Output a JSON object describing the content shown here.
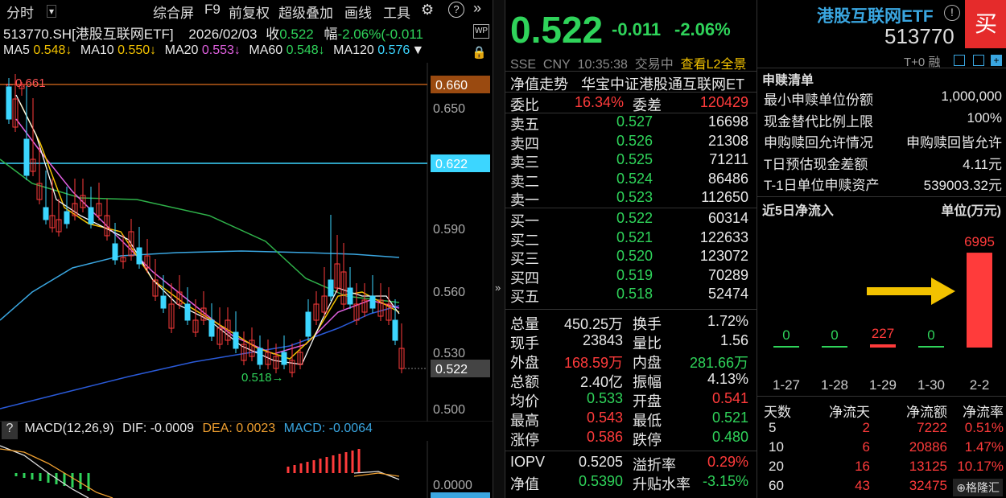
{
  "toolbar": {
    "timeshare": "分时",
    "combined": "综合屏",
    "f9": "F9",
    "adjust": "前复权",
    "overlay": "超级叠加",
    "draw": "画线",
    "tools": "工具"
  },
  "info": {
    "code": "513770.SH[港股互联网ETF]",
    "date": "2026/02/03",
    "close_label": "收",
    "close": "0.522",
    "chg_label": "幅",
    "chg": "-2.06%(-0.011"
  },
  "ma": {
    "ma5": "MA5",
    "ma5v": "0.548↓",
    "ma10": "MA10",
    "ma10v": "0.550↓",
    "ma20": "MA20",
    "ma20v": "0.553↓",
    "ma60": "MA60",
    "ma60v": "0.548↓",
    "ma120": "MA120",
    "ma120v": "0.576"
  },
  "kchart": {
    "price_tags": {
      "high_tag": "0.660",
      "line_tag": "0.622",
      "last_tag": "0.522"
    },
    "y_ticks": [
      "0.650",
      "0.590",
      "0.560",
      "0.530",
      "0.500"
    ],
    "marker_high": "0.661",
    "marker_low": "0.518",
    "macd_zero": "0.0000",
    "macd_low": "-0.0064"
  },
  "macd": {
    "label": "MACD(12,26,9)",
    "dif": "DIF: -0.0009",
    "dea": "DEA: 0.0023",
    "macd": "MACD: -0.0064"
  },
  "quote": {
    "price": "0.522",
    "change": "-0.011",
    "pct": "-2.06%",
    "exch": "SSE",
    "cur": "CNY",
    "time": "10:35:38",
    "status": "交易中",
    "l2": "查看L2全景",
    "name": "港股互联网ETF",
    "code": "513770",
    "buy": "买",
    "t0": "T+0",
    "rong": "融"
  },
  "nav": {
    "label": "净值走势",
    "name": "华宝中证港股通互联网ET"
  },
  "wei": {
    "l1": "委比",
    "v1": "16.34%",
    "l2": "委差",
    "v2": "120429"
  },
  "asks": [
    {
      "l": "卖五",
      "p": "0.527",
      "v": "16698"
    },
    {
      "l": "卖四",
      "p": "0.526",
      "v": "21308"
    },
    {
      "l": "卖三",
      "p": "0.525",
      "v": "71211"
    },
    {
      "l": "卖二",
      "p": "0.524",
      "v": "86486"
    },
    {
      "l": "卖一",
      "p": "0.523",
      "v": "112650"
    }
  ],
  "bids": [
    {
      "l": "买一",
      "p": "0.522",
      "v": "60314"
    },
    {
      "l": "买二",
      "p": "0.521",
      "v": "122633"
    },
    {
      "l": "买三",
      "p": "0.520",
      "v": "123072"
    },
    {
      "l": "买四",
      "p": "0.519",
      "v": "70289"
    },
    {
      "l": "买五",
      "p": "0.518",
      "v": "52474"
    }
  ],
  "stats": [
    {
      "l1": "总量",
      "v1": "450.25万",
      "l2": "换手",
      "v2": "1.72%"
    },
    {
      "l1": "现手",
      "v1": "23843",
      "l2": "量比",
      "v2": "1.56"
    },
    {
      "l1": "外盘",
      "v1": "168.59万",
      "l2": "内盘",
      "v2": "281.66万"
    },
    {
      "l1": "总额",
      "v1": "2.40亿",
      "l2": "振幅",
      "v2": "4.13%"
    },
    {
      "l1": "均价",
      "v1": "0.533",
      "l2": "开盘",
      "v2": "0.541"
    },
    {
      "l1": "最高",
      "v1": "0.543",
      "l2": "最低",
      "v2": "0.521"
    },
    {
      "l1": "涨停",
      "v1": "0.586",
      "l2": "跌停",
      "v2": "0.480"
    }
  ],
  "iopv": [
    {
      "l1": "IOPV",
      "v1": "0.5205",
      "l2": "溢折率",
      "v2": "0.29%"
    },
    {
      "l1": "净值",
      "v1": "0.5390",
      "l2": "升贴水率",
      "v2": "-3.15%"
    }
  ],
  "redeem": {
    "title": "申赎清单",
    "rows": [
      {
        "l": "最小申赎单位份额",
        "v": "1,000,000"
      },
      {
        "l": "现金替代比例上限",
        "v": "100%"
      },
      {
        "l": "申购赎回允许情况",
        "v": "申购赎回皆允许"
      },
      {
        "l": "T日预估现金差额",
        "v": "4.11元"
      },
      {
        "l": "T-1日单位申赎资产",
        "v": "539003.32元"
      }
    ]
  },
  "flow": {
    "title": "近5日净流入",
    "unit": "单位(万元)",
    "bars": [
      {
        "d": "1-27",
        "v": 0,
        "t": "0"
      },
      {
        "d": "1-28",
        "v": 0,
        "t": "0"
      },
      {
        "d": "1-29",
        "v": 227,
        "t": "227"
      },
      {
        "d": "1-30",
        "v": 0,
        "t": "0"
      },
      {
        "d": "2-2",
        "v": 6995,
        "t": "6995"
      }
    ]
  },
  "flowtable": {
    "headers": [
      "天数",
      "净流天",
      "净流额",
      "净流率"
    ],
    "rows": [
      [
        "5",
        "2",
        "7222",
        "0.51%"
      ],
      [
        "10",
        "6",
        "20886",
        "1.47%"
      ],
      [
        "20",
        "16",
        "13125",
        "10.17%"
      ],
      [
        "60",
        "43",
        "32475",
        "..."
      ]
    ]
  },
  "watermark": "格隆汇"
}
